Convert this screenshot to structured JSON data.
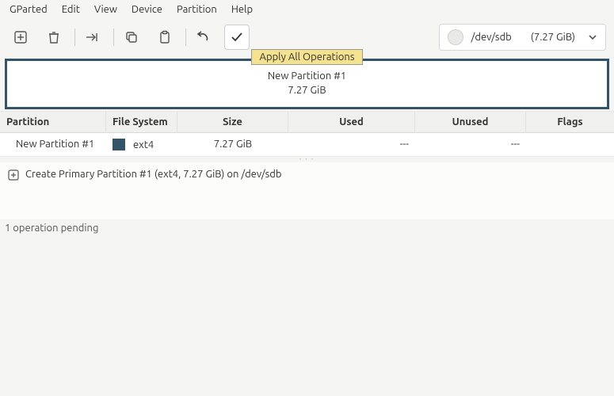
{
  "menu": {
    "gparted": "GParted",
    "edit": "Edit",
    "view": "View",
    "device": "Device",
    "partition": "Partition",
    "help": "Help"
  },
  "toolbar": {
    "tooltip": "Apply All Operations"
  },
  "device_selector": {
    "path": "/dev/sdb",
    "size": "(7.27 GiB)"
  },
  "diagram": {
    "name": "New Partition #1",
    "size": "7.27 GiB"
  },
  "table": {
    "headers": {
      "partition": "Partition",
      "fs": "File System",
      "size": "Size",
      "used": "Used",
      "unused": "Unused",
      "flags": "Flags"
    },
    "rows": [
      {
        "partition": "New Partition #1",
        "fs": "ext4",
        "size": "7.27 GiB",
        "used": "---",
        "unused": "---",
        "flags": ""
      }
    ]
  },
  "pending": {
    "op": "Create Primary Partition #1 (ext4, 7.27 GiB) on /dev/sdb"
  },
  "status": {
    "text": "1 operation pending"
  }
}
